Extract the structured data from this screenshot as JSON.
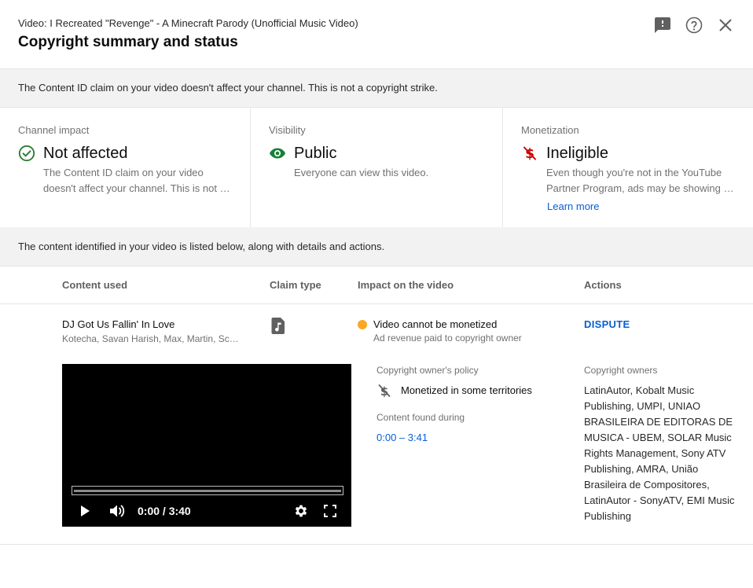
{
  "header": {
    "video_title": "Video: I Recreated \"Revenge\" - A Minecraft Parody (Unofficial Music Video)",
    "title": "Copyright summary and status",
    "icons": [
      "feedback-icon",
      "help-icon",
      "close-icon"
    ]
  },
  "banner_top": "The Content ID claim on your video doesn't affect your channel. This is not a copyright strike.",
  "impact": {
    "channel": {
      "label": "Channel impact",
      "value": "Not affected",
      "desc_line1": "The Content ID claim on your video",
      "desc_line2": "doesn't affect your channel. This is not a copyright strike.",
      "icon": "check-circle-icon"
    },
    "visibility": {
      "label": "Visibility",
      "value": "Public",
      "desc": "Everyone can view this video.",
      "icon": "eye-icon"
    },
    "monetization": {
      "label": "Monetization",
      "value": "Ineligible",
      "desc_line1": "Even though you're not in the YouTube",
      "desc_line2": "Partner Program, ads may be showing on this video.",
      "learn_more": "Learn more",
      "icon": "no-money-icon"
    }
  },
  "banner_mid": "The content identified in your video is listed below, along with details and actions.",
  "table": {
    "headers": [
      "Content used",
      "Claim type",
      "Impact on the video",
      "Actions"
    ],
    "rows": [
      {
        "title": "DJ Got Us Fallin' In Love",
        "artists": "Kotecha, Savan Harish, Max, Martin, Schuster",
        "claim_type_icon": "music-note-icon",
        "impact_main": "Video cannot be monetized",
        "impact_sub": "Ad revenue paid to copyright owner",
        "action": "DISPUTE",
        "policy_label": "Copyright owner's policy",
        "policy_value": "Monetized in some territories",
        "found_label": "Content found during",
        "found_range": "0:00 – 3:41",
        "owners_label": "Copyright owners",
        "owners": "LatinAutor, Kobalt Music Publishing, UMPI, UNIAO BRASILEIRA DE EDITORAS DE MUSICA - UBEM, SOLAR Music Rights Management, Sony ATV Publishing, AMRA, União Brasileira de Compositores, LatinAutor - SonyATV, EMI Music Publishing",
        "player": {
          "time": "0:00 / 3:40",
          "progress": 0.0
        }
      }
    ]
  },
  "colors": {
    "accent_blue": "#065fd4",
    "check_green": "#2e7d32",
    "eye_green": "#188038",
    "ineligible_red": "#c00",
    "warning_orange": "#f9a825"
  }
}
